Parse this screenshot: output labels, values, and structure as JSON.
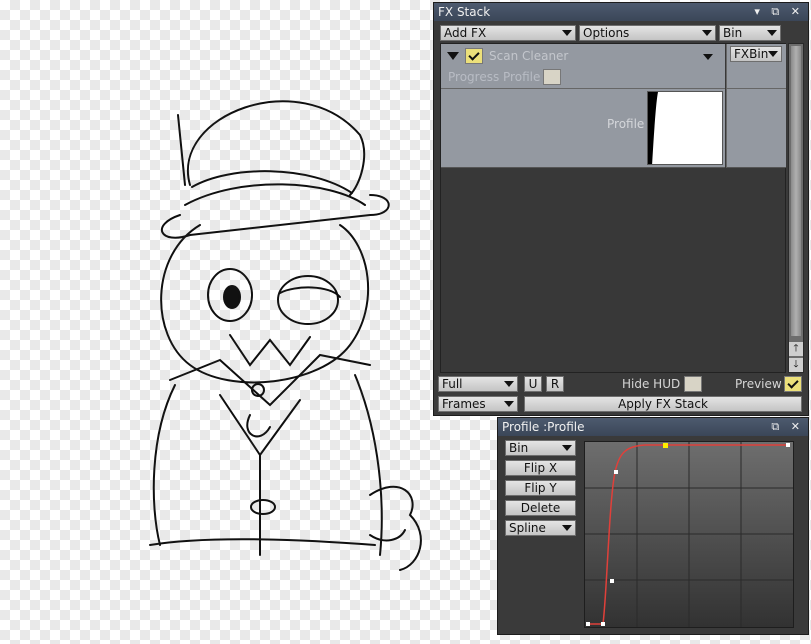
{
  "fx_stack": {
    "title": "FX Stack",
    "add_fx_label": "Add FX",
    "options_label": "Options",
    "bin_label": "Bin",
    "effect": {
      "name": "Scan Cleaner",
      "enabled": true,
      "progress_profile_label": "Progress Profile",
      "profile_label": "Profile",
      "fxbin_label": "FXBin"
    },
    "footer": {
      "quality_value": "Full",
      "u_label": "U",
      "r_label": "R",
      "hide_hud_label": "Hide HUD",
      "preview_label": "Preview",
      "preview_enabled": true,
      "frames_value": "Frames",
      "apply_label": "Apply FX Stack"
    }
  },
  "profile_panel": {
    "title": "Profile :Profile",
    "bin_value": "Bin",
    "flip_x_label": "Flip X",
    "flip_y_label": "Flip Y",
    "delete_label": "Delete",
    "interp_value": "Spline"
  },
  "colors": {
    "accent_check": "#ece07a",
    "curve": "#e0403a",
    "selected_point": "#ffee00"
  }
}
